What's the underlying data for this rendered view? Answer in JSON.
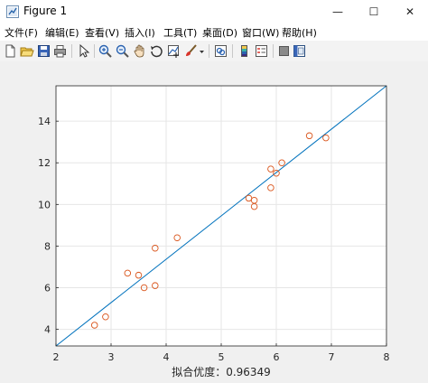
{
  "window": {
    "title": "Figure 1",
    "minimize_glyph": "—",
    "maximize_glyph": "☐",
    "close_glyph": "✕"
  },
  "menu": [
    "文件(F)",
    "编辑(E)",
    "查看(V)",
    "插入(I)",
    "工具(T)",
    "桌面(D)",
    "窗口(W)",
    "帮助(H)"
  ],
  "toolbar_icons": [
    "new-figure-icon",
    "open-file-icon",
    "save-icon",
    "print-icon",
    "pointer-icon",
    "zoom-in-icon",
    "zoom-out-icon",
    "pan-hand-icon",
    "rotate-3d-icon",
    "data-cursor-icon",
    "brush-icon",
    "brush-dropdown-icon",
    "link-plot-icon",
    "colorbar-icon",
    "legend-icon",
    "hide-plot-tools-icon",
    "show-plot-tools-icon"
  ],
  "colors": {
    "line": "#0072bd",
    "marker": "#d95319",
    "axes_bg": "#ffffff",
    "grid": "#e6e6e6"
  },
  "chart_data": {
    "type": "scatter",
    "xlabel": "拟合优度：0.96349",
    "ylabel": "",
    "title": "",
    "xlim": [
      2,
      8
    ],
    "ylim": [
      3.2,
      15.7
    ],
    "xticks": [
      2,
      3,
      4,
      5,
      6,
      7,
      8
    ],
    "yticks": [
      4,
      6,
      8,
      10,
      12,
      14
    ],
    "grid": true,
    "points": [
      [
        2.7,
        4.2
      ],
      [
        2.9,
        4.6
      ],
      [
        3.3,
        6.7
      ],
      [
        3.5,
        6.6
      ],
      [
        3.6,
        6.0
      ],
      [
        3.8,
        6.1
      ],
      [
        3.8,
        7.9
      ],
      [
        4.2,
        8.4
      ],
      [
        5.5,
        10.3
      ],
      [
        5.6,
        10.2
      ],
      [
        5.6,
        9.9
      ],
      [
        5.9,
        11.7
      ],
      [
        5.9,
        10.8
      ],
      [
        6.0,
        11.5
      ],
      [
        6.1,
        12.0
      ],
      [
        6.6,
        13.3
      ],
      [
        6.9,
        13.2
      ]
    ],
    "reference_line": [
      [
        2,
        3.2
      ],
      [
        8,
        15.7
      ]
    ]
  }
}
